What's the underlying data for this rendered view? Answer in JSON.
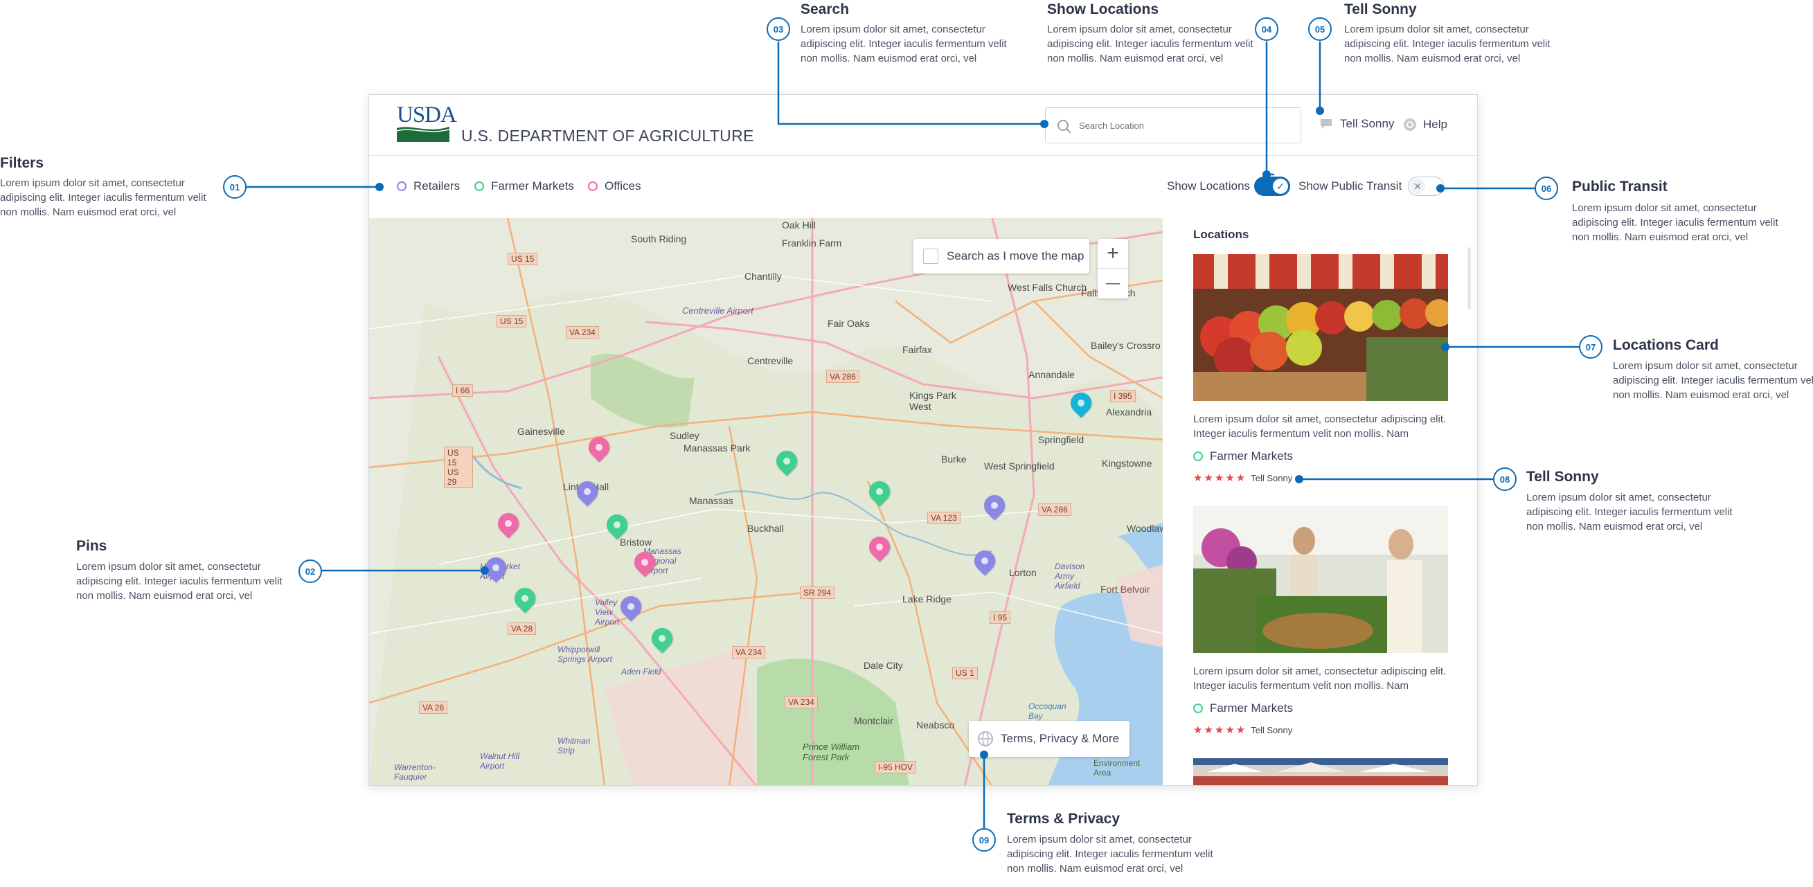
{
  "annotations": {
    "lorem": "Lorem ipsum dolor sit amet, consectetur adipiscing elit. Integer iaculis fermentum velit non mollis. Nam euismod erat orci, vel",
    "filters": {
      "num": "01",
      "title": "Filters"
    },
    "pins": {
      "num": "02",
      "title": "Pins"
    },
    "search": {
      "num": "03",
      "title": "Search"
    },
    "show_locations": {
      "num": "04",
      "title": "Show Locations"
    },
    "tell_sonny_top": {
      "num": "05",
      "title": "Tell Sonny"
    },
    "public_transit": {
      "num": "06",
      "title": "Public Transit"
    },
    "locations_card": {
      "num": "07",
      "title": "Locations Card"
    },
    "tell_sonny_card": {
      "num": "08",
      "title": "Tell Sonny"
    },
    "terms": {
      "num": "09",
      "title": "Terms & Privacy"
    }
  },
  "header": {
    "logo_text": "USDA",
    "agency": "U.S. DEPARTMENT OF AGRICULTURE",
    "search_placeholder": "Search Location",
    "tell_sonny": "Tell Sonny",
    "help": "Help"
  },
  "filters": {
    "items": [
      {
        "label": "Retailers",
        "color": "#8b87e6"
      },
      {
        "label": "Farmer Markets",
        "color": "#3fcf8e"
      },
      {
        "label": "Offices",
        "color": "#f06aaa"
      }
    ],
    "show_locations": "Show Locations",
    "show_public_transit": "Show Public Transit"
  },
  "map": {
    "search_as_move": "Search as I move the map",
    "zoom_in": "+",
    "zoom_out": "—",
    "terms": "Terms, Privacy & More",
    "places": [
      "South Riding",
      "Oak Hill",
      "Franklin Farm",
      "Chantilly",
      "Centreville Airport",
      "Fair Oaks",
      "West Falls Church",
      "Falls Church",
      "Bailey's Crossro",
      "Centreville",
      "Fairfax",
      "Annandale",
      "Gainesville",
      "Kings Park West",
      "Sudley",
      "Manassas Park",
      "Burke",
      "West Springfield",
      "Springfield",
      "Kingstowne",
      "Alexandria",
      "Linton Hall",
      "Manassas",
      "Buckhall",
      "Bristow",
      "Manassas Regional Airport",
      "Lorton",
      "Woodlawn",
      "Davison Army Airfield",
      "Fort Belvoir",
      "Haymarket Airport",
      "Lake Ridge",
      "Valley View Airport",
      "Whipporwill Springs Airport",
      "Aden Field",
      "Dale City",
      "Occoquan Bay",
      "Montclair",
      "Neabsco",
      "Whitman Strip",
      "Prince William Forest Park",
      "Walnut Hill Airport",
      "Warrenton-Fauquier",
      "Environment Area"
    ],
    "shields": [
      "US 15",
      "US 15",
      "VA 234",
      "I 66",
      "US 15 US 29",
      "VA 286",
      "I 395",
      "VA 123",
      "VA 286",
      "SR 294",
      "I 95",
      "VA 28",
      "VA 234",
      "US 1",
      "VA 234",
      "VA 28",
      "I-95 HOV"
    ]
  },
  "panel": {
    "heading": "Locations",
    "cards": [
      {
        "text": "Lorem ipsum dolor sit amet, consectetur adipiscing elit. Integer iaculis fermentum velit non mollis. Nam",
        "category": "Farmer Markets",
        "stars": "★★★★★",
        "tell": "Tell Sonny"
      },
      {
        "text": "Lorem ipsum dolor sit amet, consectetur adipiscing elit. Integer iaculis fermentum velit non mollis. Nam",
        "category": "Farmer Markets",
        "stars": "★★★★★",
        "tell": "Tell Sonny"
      }
    ]
  },
  "colors": {
    "accent": "#0b6bb8",
    "retailer": "#8b87e6",
    "farmer": "#3fcf8e",
    "office": "#f06aaa",
    "transit": "#16b3d6",
    "star": "#e8484b"
  }
}
